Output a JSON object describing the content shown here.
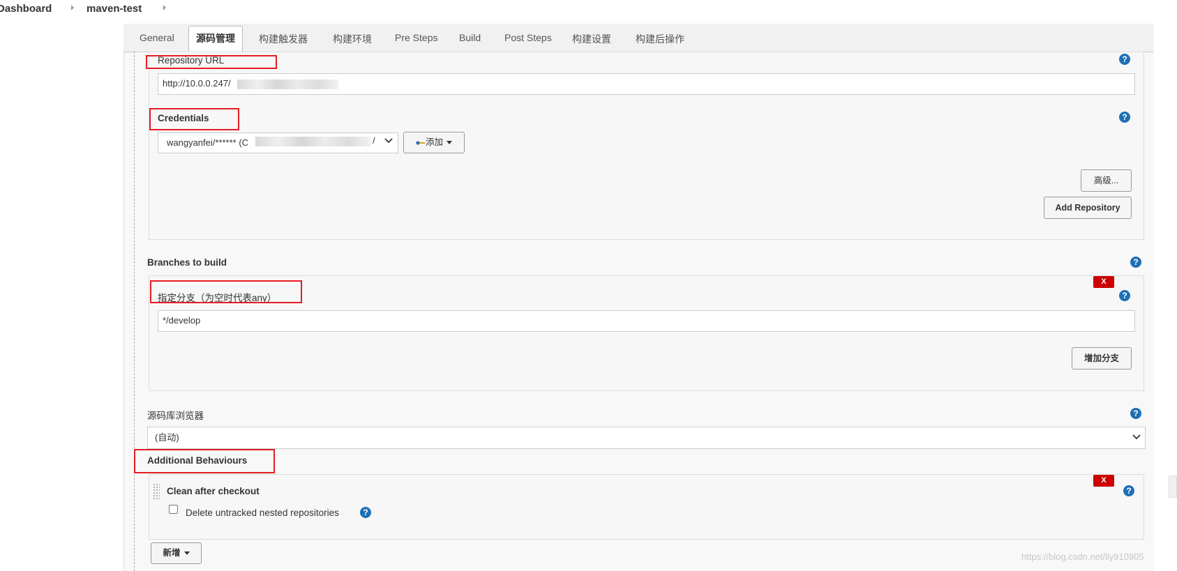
{
  "breadcrumb": {
    "items": [
      "Dashboard",
      "maven-test"
    ]
  },
  "tabs": [
    "General",
    "源码管理",
    "构建触发器",
    "构建环境",
    "Pre Steps",
    "Build",
    "Post Steps",
    "构建设置",
    "构建后操作"
  ],
  "active_tab": "源码管理",
  "repository": {
    "url_label": "Repository URL",
    "url_value": "http://10.0.0.247/",
    "credentials_label": "Credentials",
    "credentials_value": "wangyanfei/****** (C",
    "credentials_tail": "/",
    "add_button": "添加",
    "advanced_button": "高级...",
    "add_repository_button": "Add Repository"
  },
  "branches": {
    "label": "Branches to build",
    "branch_label": "指定分支（为空时代表any）",
    "branch_value": "*/develop",
    "add_branch_button": "增加分支",
    "delete_label": "X"
  },
  "browser": {
    "label": "源码库浏览器",
    "value": "(自动)"
  },
  "behaviours": {
    "label": "Additional Behaviours",
    "item_title": "Clean after checkout",
    "checkbox_label": "Delete untracked nested repositories",
    "delete_label": "X",
    "add_button": "新增"
  },
  "help_symbol": "?",
  "watermark": "https://blog.csdn.net/lly910905",
  "colors": {
    "highlight": "#e51c23",
    "help": "#1f6fb5",
    "delete": "#cc0000"
  }
}
